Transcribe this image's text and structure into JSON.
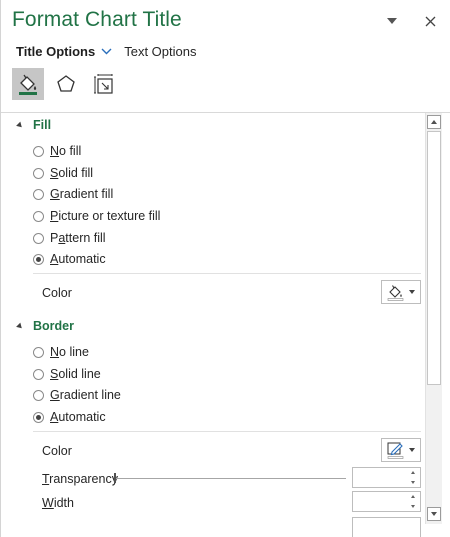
{
  "pane": {
    "title": "Format Chart Title"
  },
  "tabs": {
    "active": "Title Options",
    "other": "Text Options"
  },
  "icons": [
    "fill-line-icon",
    "effects-icon",
    "size-properties-icon"
  ],
  "fill": {
    "heading": "Fill",
    "options": [
      {
        "u": "N",
        "rest": "o fill",
        "selected": false
      },
      {
        "u": "S",
        "rest": "olid fill",
        "selected": false
      },
      {
        "u": "G",
        "rest": "radient fill",
        "selected": false
      },
      {
        "u": "P",
        "rest": "icture or texture fill",
        "selected": false
      },
      {
        "pre": "P",
        "u": "a",
        "rest": "ttern fill",
        "selected": false
      },
      {
        "u": "A",
        "rest": "utomatic",
        "selected": true
      }
    ],
    "color_label": "Color"
  },
  "border": {
    "heading": "Border",
    "options": [
      {
        "u": "N",
        "rest": "o line",
        "selected": false
      },
      {
        "u": "S",
        "rest": "olid line",
        "selected": false
      },
      {
        "u": "G",
        "rest": "radient line",
        "selected": false
      },
      {
        "u": "A",
        "rest": "utomatic",
        "selected": true
      }
    ],
    "color_label": "Color",
    "transparency": {
      "u": "T",
      "rest": "ransparency",
      "value": ""
    },
    "width": {
      "u": "W",
      "rest": "idth",
      "value": ""
    }
  },
  "colors": {
    "accent": "#217346",
    "selected_icon_bg": "#c6c6c6"
  }
}
